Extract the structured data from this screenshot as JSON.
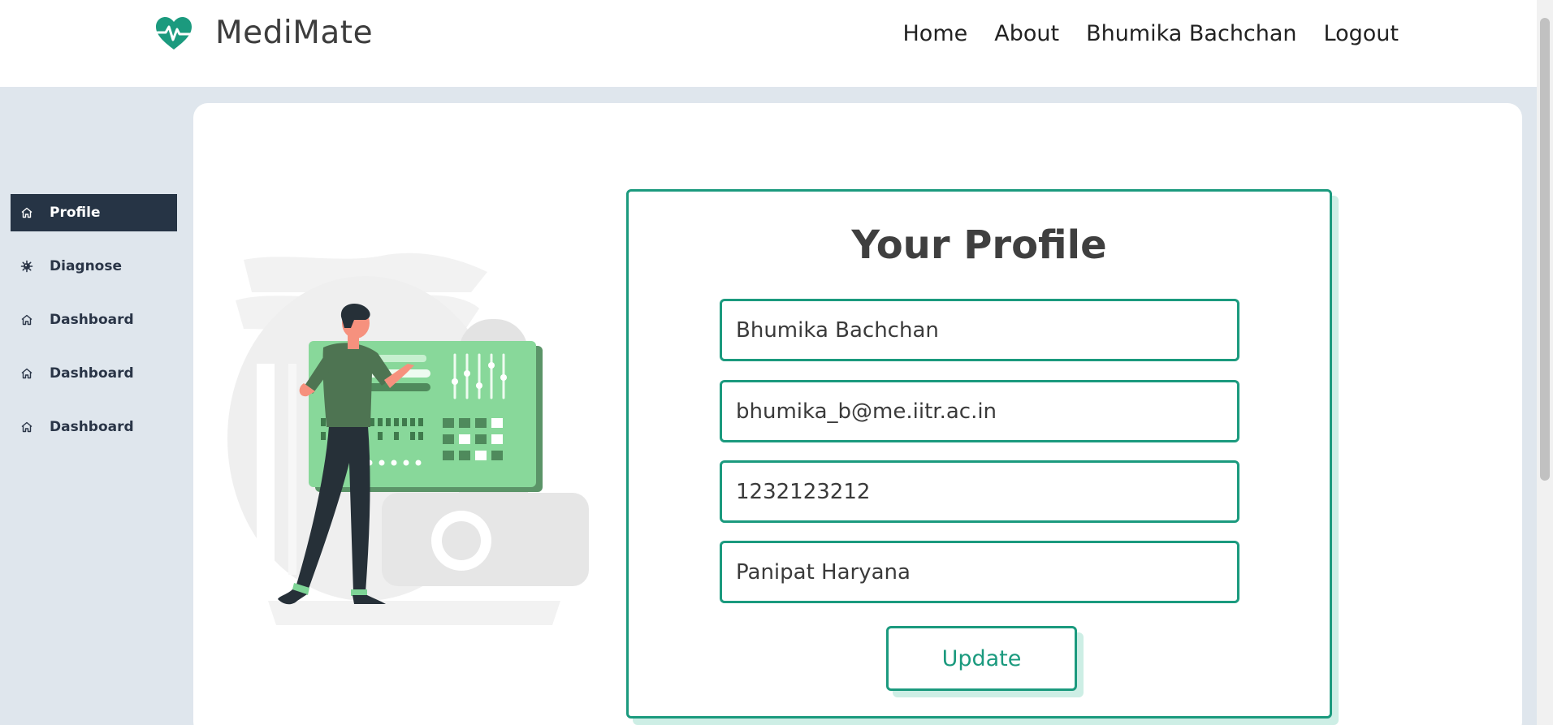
{
  "brand": {
    "name": "MediMate",
    "logo_icon": "heart-pulse-icon",
    "accent": "#1b9a7e"
  },
  "nav": {
    "home": "Home",
    "about": "About",
    "user": "Bhumika Bachchan",
    "logout": "Logout"
  },
  "sidebar": {
    "items": [
      {
        "label": "Profile",
        "icon": "home-icon",
        "active": true
      },
      {
        "label": "Diagnose",
        "icon": "virus-icon",
        "active": false
      },
      {
        "label": "Dashboard",
        "icon": "home-icon",
        "active": false
      },
      {
        "label": "Dashboard",
        "icon": "home-icon",
        "active": false
      },
      {
        "label": "Dashboard",
        "icon": "home-icon",
        "active": false
      }
    ]
  },
  "profile": {
    "title": "Your Profile",
    "name": "Bhumika Bachchan",
    "email": "bhumika_b@me.iitr.ac.in",
    "phone": "1232123212",
    "address": "Panipat Haryana",
    "update_label": "Update"
  },
  "colors": {
    "accent": "#1b9a7e",
    "sidebar_active": "#263445",
    "background": "#dfe6ed",
    "shadow": "#cdeee5"
  }
}
